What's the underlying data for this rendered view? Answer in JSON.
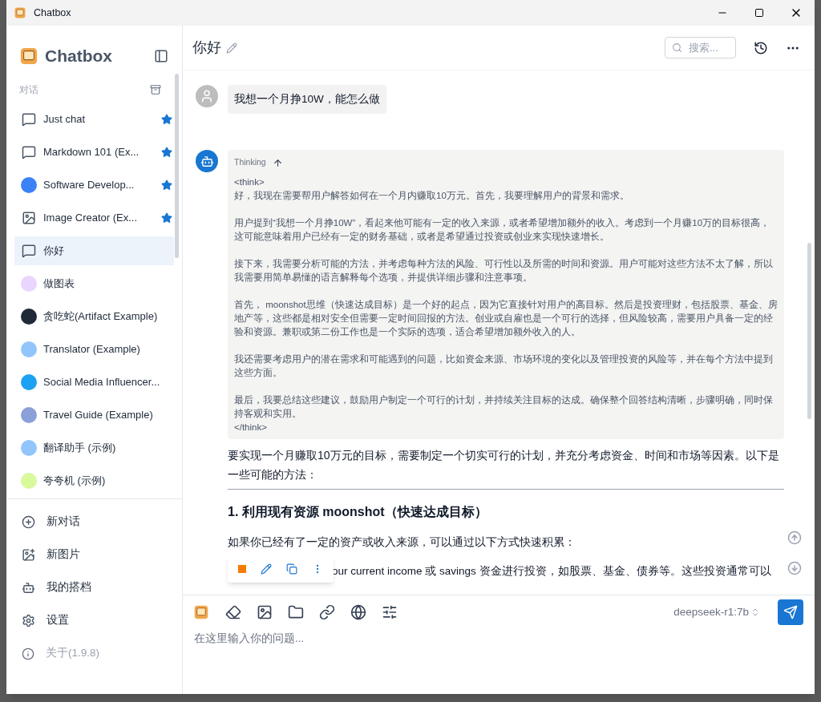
{
  "window": {
    "title": "Chatbox"
  },
  "sidebar": {
    "brand": "Chatbox",
    "section_label": "对话",
    "conversations": [
      {
        "label": "Just chat",
        "kind": "chat",
        "starred": true,
        "selected": false
      },
      {
        "label": "Markdown 101 (Ex...",
        "kind": "chat",
        "starred": true,
        "selected": false
      },
      {
        "label": "Software Develop...",
        "kind": "picture",
        "color": "#3b82f6",
        "starred": true,
        "selected": false
      },
      {
        "label": "Image Creator (Ex...",
        "kind": "image",
        "starred": true,
        "selected": false
      },
      {
        "label": "你好",
        "kind": "chat",
        "starred": false,
        "selected": true
      },
      {
        "label": "做图表",
        "kind": "picture",
        "color": "#e9d5ff",
        "starred": false,
        "selected": false
      },
      {
        "label": "贪吃蛇(Artifact Example)",
        "kind": "picture",
        "color": "#1f2937",
        "starred": false,
        "selected": false
      },
      {
        "label": "Translator (Example)",
        "kind": "picture",
        "color": "#93c5fd",
        "starred": false,
        "selected": false
      },
      {
        "label": "Social Media Influencer...",
        "kind": "picture",
        "color": "#1da1f2",
        "starred": false,
        "selected": false
      },
      {
        "label": "Travel Guide (Example)",
        "kind": "picture",
        "color": "#8b9fd8",
        "starred": false,
        "selected": false
      },
      {
        "label": "翻译助手 (示例)",
        "kind": "picture",
        "color": "#93c5fd",
        "starred": false,
        "selected": false
      },
      {
        "label": "夸夸机 (示例)",
        "kind": "picture",
        "color": "#d9f99d",
        "starred": false,
        "selected": false
      }
    ],
    "actions": [
      {
        "label": "新对话",
        "kind": "new-chat"
      },
      {
        "label": "新图片",
        "kind": "new-image"
      },
      {
        "label": "我的搭档",
        "kind": "partners"
      },
      {
        "label": "设置",
        "kind": "settings"
      }
    ],
    "about": "关于(1.9.8)"
  },
  "header": {
    "title": "你好",
    "search_placeholder": "搜索..."
  },
  "user_message": "我想一个月挣10W，能怎么做",
  "assistant": {
    "thinking_label": "Thinking",
    "think_open": "<think>",
    "think_paragraphs": [
      "好，我现在需要帮用户解答如何在一个月内赚取10万元。首先，我要理解用户的背景和需求。",
      "用户提到“我想一个月挣10W”，看起来他可能有一定的收入来源，或者希望增加额外的收入。考虑到一个月赚10万的目标很高，这可能意味着用户已经有一定的财务基础，或者是希望通过投资或创业来实现快速增长。",
      "接下来，我需要分析可能的方法，并考虑每种方法的风险、可行性以及所需的时间和资源。用户可能对这些方法不太了解，所以我需要用简单易懂的语言解释每个选项，并提供详细步骤和注意事项。",
      "首先， moonshot思维（快速达成目标）是一个好的起点，因为它直接针对用户的高目标。然后是投资理财，包括股票、基金、房地产等，这些都是相对安全但需要一定时间回报的方法。创业或自雇也是一个可行的选择，但风险较高，需要用户具备一定的经验和资源。兼职或第二份工作也是一个实际的选项，适合希望增加额外收入的人。",
      "我还需要考虑用户的潜在需求和可能遇到的问题，比如资金来源、市场环境的变化以及管理投资的风险等，并在每个方法中提到这些方面。",
      "最后，我要总结这些建议，鼓励用户制定一个可行的计划，并持续关注目标的达成。确保整个回答结构清晰，步骤明确，同时保持客观和实用。"
    ],
    "think_close": "</think>",
    "intro": "要实现一个月赚取10万元的目标，需要制定一个切实可行的计划，并充分考虑资金、时间和市场等因素。以下是一些可能的方法：",
    "heading": "1. 利用现有资源 moonshot（快速达成目标）",
    "paragraph": "如果你已经有了一定的资产或收入来源，可以通过以下方式快速积累：",
    "bullet_visible": "our current income 或 savings 资金进行投资，如股票、基金、债券等。这些投资通常可以"
  },
  "composer": {
    "model": "deepseek-r1:7b",
    "placeholder": "在这里输入你的问题..."
  }
}
